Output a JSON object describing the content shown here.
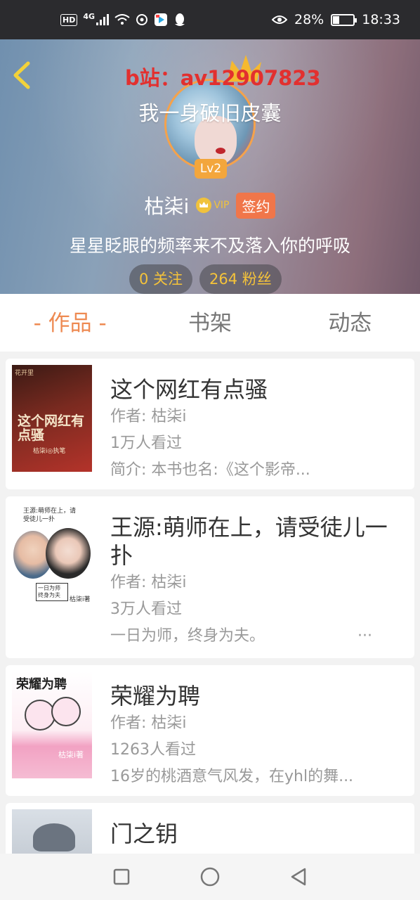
{
  "status_bar": {
    "hd": "HD",
    "network": "4G",
    "battery": "28%",
    "battery_level": 0.28,
    "time": "18:33"
  },
  "header": {
    "watermark": "b站：av12907823",
    "subtitle": "我一身破旧皮囊",
    "level": "Lv2",
    "nickname": "枯柒i",
    "vip": "VIP",
    "sign_badge": "签约",
    "bio": "星星眨眼的频率来不及落入你的呼吸",
    "following": "0 关注",
    "followers": "264 粉丝"
  },
  "tabs": [
    "- 作品 -",
    "书架",
    "动态"
  ],
  "books": [
    {
      "title": "这个网红有点骚",
      "author": "作者: 枯柒i",
      "views": "1万人看过",
      "summary": "简介: 本书也名:《这个影帝...",
      "cover_text": "这个网红有点骚",
      "cover_sub": "枯柒i◎执笔",
      "cover_corner": "花开里"
    },
    {
      "title": "王源:萌师在上，请受徒儿一扑",
      "author": "作者: 枯柒i",
      "views": "3万人看过",
      "summary": "一日为师，终身为夫。",
      "summary_more": "···",
      "cover_text": "王源:萌师在上，请受徒儿一扑",
      "cover_sub": "枯柒i著",
      "cover_note": "一日为师 终身为夫"
    },
    {
      "title": "荣耀为聘",
      "author": "作者: 枯柒i",
      "views": "1263人看过",
      "summary": "16岁的桃酒意气风发，在yhl的舞...",
      "cover_text": "荣耀为聘",
      "cover_sub": "枯柒i著"
    },
    {
      "title": "门之钥",
      "author": "",
      "views": "",
      "summary": ""
    }
  ]
}
